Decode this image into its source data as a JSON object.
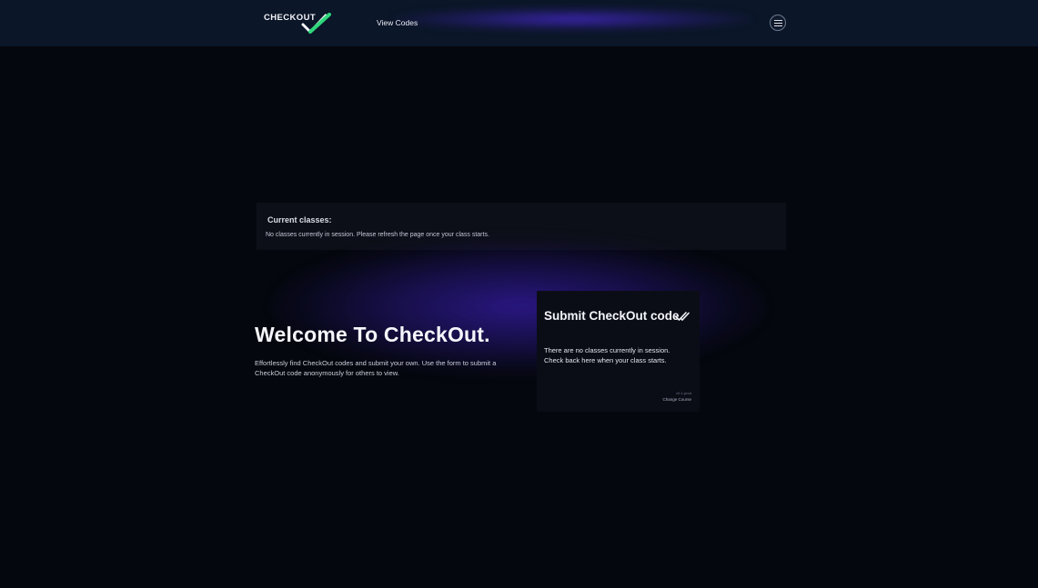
{
  "header": {
    "logo_text": "CHECKOUT",
    "nav_link": "View Codes",
    "menu_icon": "hamburger-menu-icon"
  },
  "current_classes": {
    "title": "Current classes:",
    "message": "No classes currently in session. Please refresh the page once your class starts."
  },
  "welcome": {
    "title": "Welcome To CheckOut.",
    "description": "Effortlessly find CheckOut codes and submit your own. Use the form to submit a CheckOut code anonymously for others to view."
  },
  "submit_card": {
    "title": "Submit CheckOut code",
    "icon": "double-check-icon",
    "message": "There are no classes currently in session. Check back here when your class starts.",
    "version": "v0.1-prod",
    "change_course": "Change Course"
  },
  "colors": {
    "background": "#05070e",
    "header": "#0b1628",
    "accent_green": "#2fd67b",
    "glow_purple": "#3a22aa"
  }
}
